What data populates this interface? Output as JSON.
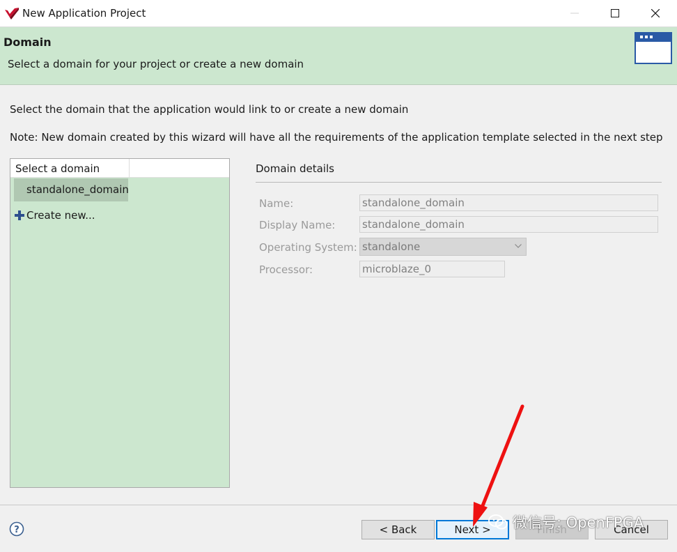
{
  "window": {
    "title": "New Application Project",
    "controls": [
      "minimize-icon",
      "maximize-icon",
      "close-icon"
    ]
  },
  "banner": {
    "title": "Domain",
    "subtitle": "Select a domain for your project or create a new domain",
    "icon": "window-icon"
  },
  "instructions": {
    "line1": "Select the domain that the application would link to or create a new domain",
    "line2": "Note: New domain created by this wizard will have all the requirements of the application template selected in the next step"
  },
  "domain_list": {
    "header": "Select a domain",
    "items": [
      {
        "label": "standalone_domain",
        "selected": true
      }
    ],
    "create_label": "Create new..."
  },
  "details": {
    "heading": "Domain details",
    "fields": {
      "name": {
        "label": "Name:",
        "value": "standalone_domain"
      },
      "display_name": {
        "label": "Display Name:",
        "value": "standalone_domain"
      },
      "os": {
        "label": "Operating System:",
        "value": "standalone"
      },
      "processor": {
        "label": "Processor:",
        "value": "microblaze_0"
      }
    }
  },
  "footer": {
    "back": "< Back",
    "next": "Next >",
    "finish": "Finish",
    "cancel": "Cancel"
  },
  "watermark": {
    "text": "微信号: OpenFPGA"
  },
  "colors": {
    "banner_bg": "#cce7cf",
    "list_bg": "#cce7cf",
    "selected_row": "#b0c8b2",
    "primary_border": "#0078d7",
    "annotation_arrow": "#ee1111"
  }
}
